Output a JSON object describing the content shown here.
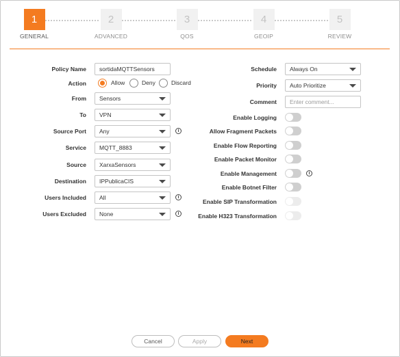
{
  "stepper": {
    "steps": [
      {
        "number": "1",
        "label": "GENERAL",
        "active": true
      },
      {
        "number": "2",
        "label": "ADVANCED",
        "active": false
      },
      {
        "number": "3",
        "label": "QOS",
        "active": false
      },
      {
        "number": "4",
        "label": "GEOIP",
        "active": false
      },
      {
        "number": "5",
        "label": "REVIEW",
        "active": false
      }
    ],
    "accent_color": "#f47b20"
  },
  "form": {
    "policy_name": {
      "label": "Policy Name",
      "value": "sortidaMQTTSensors"
    },
    "action": {
      "label": "Action",
      "options": [
        "Allow",
        "Deny",
        "Discard"
      ],
      "selected": "Allow"
    },
    "from": {
      "label": "From",
      "value": "Sensors"
    },
    "to": {
      "label": "To",
      "value": "VPN"
    },
    "source_port": {
      "label": "Source Port",
      "value": "Any"
    },
    "service": {
      "label": "Service",
      "value": "MQTT_8883"
    },
    "source": {
      "label": "Source",
      "value": "XarxaSensors"
    },
    "destination": {
      "label": "Destination",
      "value": "IPPublicaCIS"
    },
    "users_included": {
      "label": "Users Included",
      "value": "All"
    },
    "users_excluded": {
      "label": "Users Excluded",
      "value": "None"
    },
    "schedule": {
      "label": "Schedule",
      "value": "Always On"
    },
    "priority": {
      "label": "Priority",
      "value": "Auto Prioritize"
    },
    "comment": {
      "label": "Comment",
      "placeholder": "Enter comment..."
    },
    "toggles": [
      {
        "label": "Enable Logging",
        "on": false,
        "enabled": true
      },
      {
        "label": "Allow Fragment Packets",
        "on": false,
        "enabled": true
      },
      {
        "label": "Enable Flow Reporting",
        "on": false,
        "enabled": true
      },
      {
        "label": "Enable Packet Monitor",
        "on": false,
        "enabled": true
      },
      {
        "label": "Enable Management",
        "on": false,
        "enabled": true
      },
      {
        "label": "Enable Botnet Filter",
        "on": false,
        "enabled": true
      },
      {
        "label": "Enable SIP Transformation",
        "on": false,
        "enabled": false
      },
      {
        "label": "Enable H323 Transformation",
        "on": false,
        "enabled": false
      }
    ],
    "info_glyph": "i"
  },
  "footer": {
    "cancel_label": "Cancel",
    "apply_label": "Apply",
    "next_label": "Next"
  }
}
